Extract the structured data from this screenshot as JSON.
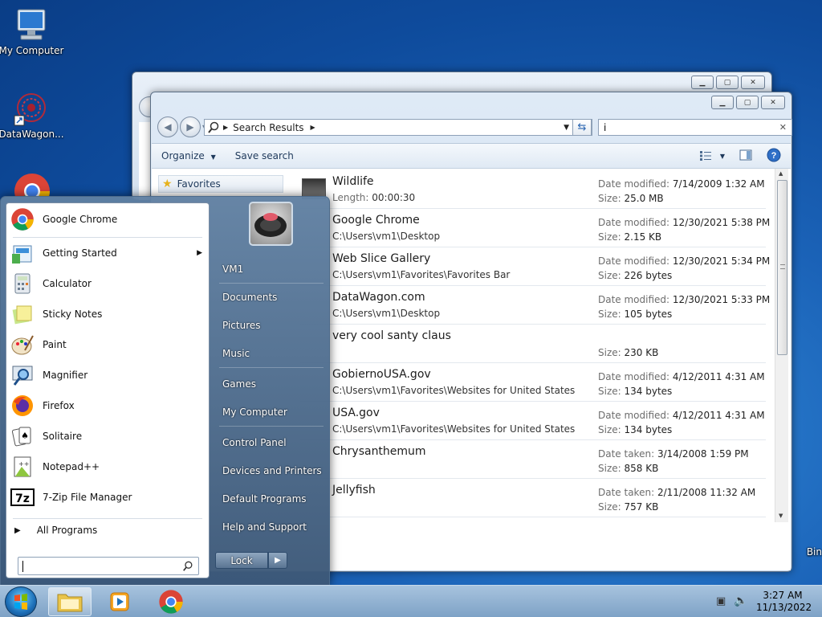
{
  "desktop": {
    "icons": [
      {
        "label": "My Computer"
      },
      {
        "label": "DataWagon..."
      },
      {
        "label": "Bin"
      }
    ]
  },
  "explorer": {
    "address": {
      "crumb": "Search Results"
    },
    "search_query": "i",
    "toolbar": {
      "organize": "Organize",
      "save_search": "Save search"
    },
    "nav": {
      "favorites": "Favorites"
    },
    "results": [
      {
        "name": "Wildlife",
        "path_label": "Length:",
        "path": "00:00:30",
        "meta1_label": "Date modified:",
        "meta1": "7/14/2009 1:32 AM",
        "meta2_label": "Size:",
        "meta2": "25.0 MB"
      },
      {
        "name": "Google Chrome",
        "path_label": "",
        "path": "C:\\Users\\vm1\\Desktop",
        "meta1_label": "Date modified:",
        "meta1": "12/30/2021 5:38 PM",
        "meta2_label": "Size:",
        "meta2": "2.15 KB"
      },
      {
        "name": "Web Slice Gallery",
        "path_label": "",
        "path": "C:\\Users\\vm1\\Favorites\\Favorites Bar",
        "meta1_label": "Date modified:",
        "meta1": "12/30/2021 5:34 PM",
        "meta2_label": "Size:",
        "meta2": "226 bytes"
      },
      {
        "name": "DataWagon.com",
        "path_label": "",
        "path": "C:\\Users\\vm1\\Desktop",
        "meta1_label": "Date modified:",
        "meta1": "12/30/2021 5:33 PM",
        "meta2_label": "Size:",
        "meta2": "105 bytes"
      },
      {
        "name": "very cool santy claus",
        "path_label": "",
        "path": "",
        "meta1_label": "",
        "meta1": "",
        "meta2_label": "Size:",
        "meta2": "230 KB"
      },
      {
        "name": "GobiernoUSA.gov",
        "path_label": "",
        "path": "C:\\Users\\vm1\\Favorites\\Websites for United States",
        "meta1_label": "Date modified:",
        "meta1": "4/12/2011 4:31 AM",
        "meta2_label": "Size:",
        "meta2": "134 bytes"
      },
      {
        "name": "USA.gov",
        "path_label": "",
        "path": "C:\\Users\\vm1\\Favorites\\Websites for United States",
        "meta1_label": "Date modified:",
        "meta1": "4/12/2011 4:31 AM",
        "meta2_label": "Size:",
        "meta2": "134 bytes"
      },
      {
        "name": "Chrysanthemum",
        "path_label": "",
        "path": "",
        "meta1_label": "Date taken:",
        "meta1": "3/14/2008 1:59 PM",
        "meta2_label": "Size:",
        "meta2": "858 KB"
      },
      {
        "name": "Jellyfish",
        "path_label": "",
        "path": "",
        "meta1_label": "Date taken:",
        "meta1": "2/11/2008 11:32 AM",
        "meta2_label": "Size:",
        "meta2": "757 KB"
      }
    ]
  },
  "start_menu": {
    "programs": [
      {
        "label": "Google Chrome",
        "icon": "chrome-icon"
      },
      {
        "label": "Getting Started",
        "icon": "getting-started-icon"
      },
      {
        "label": "Calculator",
        "icon": "calculator-icon"
      },
      {
        "label": "Sticky Notes",
        "icon": "sticky-notes-icon"
      },
      {
        "label": "Paint",
        "icon": "paint-icon"
      },
      {
        "label": "Magnifier",
        "icon": "magnifier-icon"
      },
      {
        "label": "Firefox",
        "icon": "firefox-icon"
      },
      {
        "label": "Solitaire",
        "icon": "solitaire-icon"
      },
      {
        "label": "Notepad++",
        "icon": "notepadpp-icon"
      },
      {
        "label": "7-Zip File Manager",
        "icon": "7zip-icon"
      }
    ],
    "all_programs": "All Programs",
    "search_value": "",
    "right": [
      "VM1",
      "Documents",
      "Pictures",
      "Music",
      "Games",
      "My Computer",
      "Control Panel",
      "Devices and Printers",
      "Default Programs",
      "Help and Support"
    ],
    "lock": "Lock"
  },
  "taskbar": {
    "time": "3:27 AM",
    "date": "11/13/2022"
  }
}
